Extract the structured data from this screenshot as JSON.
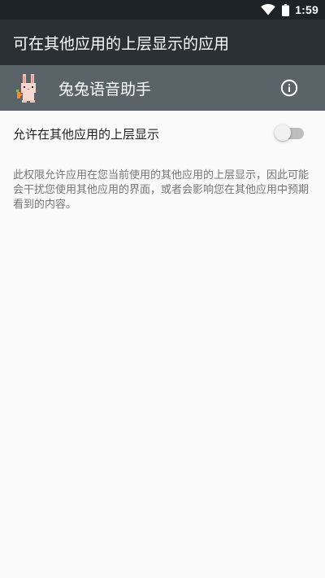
{
  "status_bar": {
    "time": "1:59",
    "wifi_icon": "wifi-icon",
    "battery_icon": "battery-icon"
  },
  "app_bar": {
    "title": "可在其他应用的上层显示的应用"
  },
  "app_header": {
    "app_name": "兔兔语音助手",
    "app_icon": "rabbit-icon",
    "info_icon": "info-icon"
  },
  "setting": {
    "label": "允许在其他应用的上层显示",
    "toggle_state": "off"
  },
  "description": "此权限允许应用在您当前使用的其他应用的上层显示，因此可能会干扰您使用其他应用的界面，或者会影响您在其他应用中预期看到的内容。",
  "colors": {
    "status_bar_bg": "#1e2327",
    "app_bar_bg": "#2a3034",
    "app_header_bg": "#5a6367",
    "page_bg": "#fafafa",
    "toggle_track_off": "#bdbdbd",
    "toggle_thumb_off": "#f1f1f1"
  }
}
